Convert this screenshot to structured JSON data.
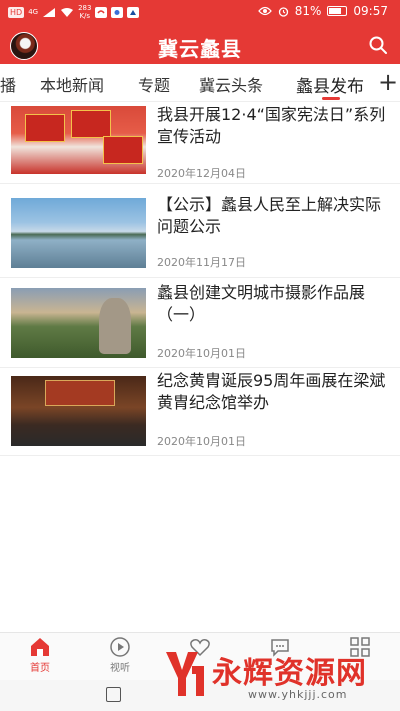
{
  "status_bar": {
    "hd_badge": "HD",
    "signal_label": "4G",
    "speed_value": "283",
    "speed_unit": "K/s",
    "battery_text": "81%",
    "battery_level": 0.81,
    "time": "09:57"
  },
  "header": {
    "title": "冀云蠡县"
  },
  "tabs": [
    {
      "label": "播",
      "active": false
    },
    {
      "label": "本地新闻",
      "active": false
    },
    {
      "label": "专题",
      "active": false
    },
    {
      "label": "冀云头条",
      "active": false
    },
    {
      "label": "蠡县发布",
      "active": true
    }
  ],
  "tab_add_label": "+",
  "news": [
    {
      "title": "我县开展12·4“国家宪法日”系列宣传活动",
      "date": "2020年12月04日"
    },
    {
      "title": "【公示】蠡县人民至上解决实际问题公示",
      "date": "2020年11月17日"
    },
    {
      "title": "蠡县创建文明城市摄影作品展（一）",
      "date": "2020年10月01日"
    },
    {
      "title": "纪念黄胄诞辰95周年画展在梁斌黄胄纪念馆举办",
      "date": "2020年10月01日"
    }
  ],
  "bottom_nav": [
    {
      "label": "首页",
      "icon": "home-icon",
      "active": true
    },
    {
      "label": "视听",
      "icon": "play-icon",
      "active": false
    },
    {
      "label": "",
      "icon": "heart-icon",
      "active": false
    },
    {
      "label": "",
      "icon": "chat-icon",
      "active": false
    },
    {
      "label": "",
      "icon": "grid-icon",
      "active": false
    }
  ],
  "watermark": {
    "text": "永辉资源网",
    "url": "www.yhkjjj.com"
  },
  "colors": {
    "brand": "#e53935",
    "text": "#222222",
    "muted": "#888888"
  }
}
